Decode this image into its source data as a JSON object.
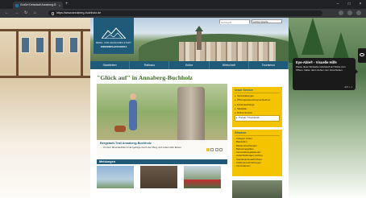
{
  "browser": {
    "tab_title": "Große Kreisstadt Annaberg-B",
    "tab_close": "×",
    "new_tab": "+",
    "url": "https://www.annaberg-buchholz.de",
    "controls": [
      "–",
      "□",
      "×"
    ],
    "nav": [
      "←",
      "→",
      "↻",
      "⌂"
    ]
  },
  "header": {
    "logo_line1": "BERG- UND ADAM-RIES-STADT",
    "logo_line2": "ANNABERG-BUCHHOLZ",
    "search_placeholder": "Suchbegriff",
    "language": "Leichte Sprache"
  },
  "nav": {
    "items": [
      "Stadtleben",
      "Rathaus",
      "Kultur",
      "Wirtschaft",
      "Tourismus"
    ]
  },
  "main": {
    "headline": "\"Glück auf\" in Annaberg-Buchholz",
    "feature_title": "Bergstadt-Trail Annaberg-Buchholz",
    "feature_text": "… mit dem Mountainbike im Erzgebirge durch den Berg und neben Aller Einem"
  },
  "service": {
    "title": "Unser Service",
    "items": [
      "Veranstaltungen",
      "Öffnungszeiten/Ansprechpartner",
      "Fristenaushänge",
      "Stadtplan",
      "Online-Service",
      "Portale / Downloads"
    ]
  },
  "gezeigt": {
    "title": "Gesehen",
    "items": [
      "Anliegen online",
      "Baustellen",
      "Bekanntmachungen",
      "Bebauungspläne",
      "Veranstaltungskalender",
      "Ausschreibungen (online)",
      "Standesamtsnachrichten",
      "Stellenausschreibungen",
      "Informationen"
    ]
  },
  "news": {
    "title": "Meldungen"
  },
  "visual_help": {
    "title": "Eye-Able® - Visuelle Hilfe",
    "text": "Passe diese Webseite individuell an! Klicke zum Öffnen, halten dann ziehen zum Verschieben.",
    "shortcut": "ALT + 1"
  }
}
